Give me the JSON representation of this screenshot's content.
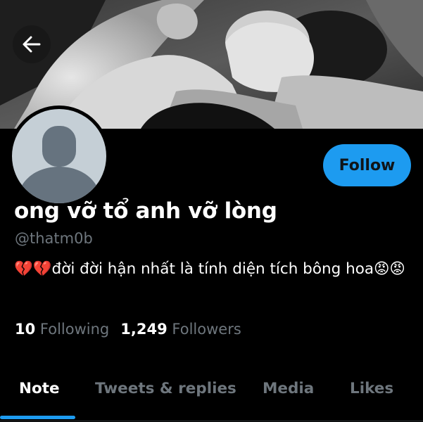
{
  "banner": {
    "icon": "profile-banner-photo"
  },
  "navigation": {
    "back_icon": "arrow-left-icon"
  },
  "avatar": {
    "icon": "default-avatar-silhouette",
    "background_color": "#c5cfd6"
  },
  "profile": {
    "follow_label": "Follow",
    "display_name": "ong vỡ tổ anh vỡ lòng",
    "handle": "@thatm0b",
    "bio_emoji_prefix": "💔💔",
    "bio_text": "đời đời hận nhất là tính diện tích bông hoa",
    "bio_emoji_suffix": "😡😡"
  },
  "stats": {
    "following_count": "10",
    "following_label": "Following",
    "followers_count": "1,249",
    "followers_label": "Followers"
  },
  "tabs": [
    {
      "label": "Note",
      "active": true
    },
    {
      "label": "Tweets & replies",
      "active": false
    },
    {
      "label": "Media",
      "active": false
    },
    {
      "label": "Likes",
      "active": false
    }
  ],
  "colors": {
    "accent": "#1d9bf0",
    "background": "#000000",
    "secondary_text": "#6e767d"
  }
}
